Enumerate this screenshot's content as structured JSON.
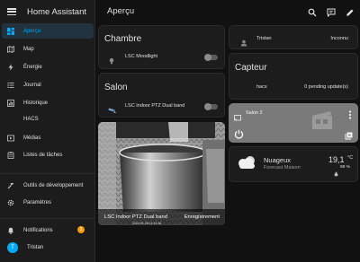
{
  "app": {
    "title": "Home Assistant",
    "page_title": "Aperçu"
  },
  "sidebar": {
    "items": [
      {
        "label": "Aperçu",
        "icon": "dashboard-icon",
        "active": true
      },
      {
        "label": "Map",
        "icon": "map-icon"
      },
      {
        "label": "Énergie",
        "icon": "lightning-icon"
      },
      {
        "label": "Journal",
        "icon": "list-icon"
      },
      {
        "label": "Historique",
        "icon": "chart-icon"
      },
      {
        "label": "HACS",
        "icon": ""
      },
      {
        "label": "Médias",
        "icon": "media-icon"
      },
      {
        "label": "Listes de tâches",
        "icon": "clipboard-icon"
      }
    ],
    "dev_tools": "Outils de développement",
    "settings": "Paramètres",
    "notifications": "Notifications",
    "notifications_count": "1",
    "user": "Tristan",
    "user_initial": "T"
  },
  "cards": {
    "chambre": {
      "title": "Chambre",
      "entity": "LSC Moodlight"
    },
    "salon": {
      "title": "Salon",
      "entity": "LSC Indoor PTZ Dual band"
    },
    "person": {
      "name": "Tristan",
      "state": "Inconnu"
    },
    "capteur": {
      "title": "Capteur",
      "entity": "hacs",
      "state": "0 pending update(s)"
    },
    "camera": {
      "name": "LSC Indoor PTZ Dual band",
      "state": "Enregistrement",
      "timestamp": "2024-01-28 11:12:16"
    },
    "media": {
      "name": "Salon 2"
    },
    "weather": {
      "condition": "Nuageux",
      "source": "Forecast Maison",
      "temperature": "19,1",
      "unit": "°C",
      "humidity": "88 %"
    }
  },
  "colors": {
    "accent": "#03a9f4",
    "badge": "#ff9800",
    "background": "#111111",
    "card": "#1c1c1c"
  }
}
